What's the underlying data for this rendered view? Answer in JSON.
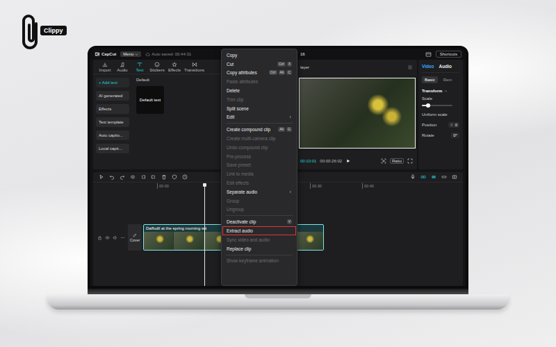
{
  "brand": {
    "name": "Clippy"
  },
  "app": {
    "logo": "CapCut",
    "menu_button": "Menu",
    "autosave": "Auto saved: 00:44:31",
    "project_title": "16",
    "shortcuts_button": "Shortcuts"
  },
  "toolbar": [
    {
      "label": "Import",
      "selected": false
    },
    {
      "label": "Audio",
      "selected": false
    },
    {
      "label": "Text",
      "selected": true
    },
    {
      "label": "Stickers",
      "selected": false
    },
    {
      "label": "Effects",
      "selected": false
    },
    {
      "label": "Transitions",
      "selected": false
    }
  ],
  "text_panel": {
    "nav": [
      {
        "label": "+ Add text",
        "selected": true
      },
      {
        "label": "AI generated",
        "selected": false
      },
      {
        "label": "Effects",
        "selected": false
      },
      {
        "label": "Text template",
        "selected": false
      },
      {
        "label": "Auto captio...",
        "selected": false
      },
      {
        "label": "Local capti...",
        "selected": false
      }
    ],
    "section": "Default",
    "presets": [
      "Default text"
    ]
  },
  "player": {
    "title": "layer",
    "current_time": "00:10:01",
    "duration": "00:00:26:02",
    "ratio_button": "Ratio"
  },
  "inspector": {
    "tabs": [
      {
        "label": "Video",
        "selected": true
      },
      {
        "label": "Audio",
        "selected": false
      }
    ],
    "subtabs": [
      {
        "label": "Basic",
        "selected": true
      },
      {
        "label": "Rem",
        "selected": false
      }
    ],
    "section": "Transform",
    "fields": [
      {
        "kind": "slider",
        "label": "Scale",
        "level": 0.2
      },
      {
        "kind": "label",
        "label": "Uniform scale"
      },
      {
        "kind": "number",
        "label": "Position",
        "axis": "X",
        "value": "0"
      },
      {
        "kind": "number",
        "label": "Rotate",
        "value": "0°"
      }
    ]
  },
  "timeline": {
    "ruler": [
      "00:00",
      "00:30",
      "00:40"
    ],
    "cover_button": "Cover",
    "clip": {
      "title": "Daffodil at the spring morning wit",
      "selected": true
    }
  },
  "context_menu": {
    "items": [
      {
        "kind": "item",
        "label": "Copy",
        "shortcut": [],
        "disabled": false,
        "submenu": false,
        "highlighted": false
      },
      {
        "kind": "item",
        "label": "Cut",
        "shortcut": [
          "Ctrl",
          "X"
        ],
        "disabled": false,
        "submenu": false,
        "highlighted": false
      },
      {
        "kind": "item",
        "label": "Copy attributes",
        "shortcut": [
          "Ctrl",
          "Alt",
          "C"
        ],
        "disabled": false,
        "submenu": false,
        "highlighted": false
      },
      {
        "kind": "item",
        "label": "Paste attributes",
        "shortcut": [],
        "disabled": true,
        "submenu": false,
        "highlighted": false
      },
      {
        "kind": "item",
        "label": "Delete",
        "shortcut": [],
        "disabled": false,
        "submenu": false,
        "highlighted": false
      },
      {
        "kind": "item",
        "label": "Trim clip",
        "shortcut": [],
        "disabled": true,
        "submenu": false,
        "highlighted": false
      },
      {
        "kind": "item",
        "label": "Split scene",
        "shortcut": [],
        "disabled": false,
        "submenu": false,
        "highlighted": false
      },
      {
        "kind": "item",
        "label": "Edit",
        "shortcut": [],
        "disabled": false,
        "submenu": true,
        "highlighted": false
      },
      {
        "kind": "separator"
      },
      {
        "kind": "item",
        "label": "Create compound clip",
        "shortcut": [
          "Alt",
          "G"
        ],
        "disabled": false,
        "submenu": false,
        "highlighted": false
      },
      {
        "kind": "item",
        "label": "Create multi-camera clip",
        "shortcut": [],
        "disabled": true,
        "submenu": false,
        "highlighted": false
      },
      {
        "kind": "item",
        "label": "Undo compound clip",
        "shortcut": [],
        "disabled": true,
        "submenu": false,
        "highlighted": false
      },
      {
        "kind": "item",
        "label": "Pre-process",
        "shortcut": [],
        "disabled": true,
        "submenu": false,
        "highlighted": false
      },
      {
        "kind": "item",
        "label": "Save preset",
        "shortcut": [],
        "disabled": true,
        "submenu": false,
        "highlighted": false
      },
      {
        "kind": "item",
        "label": "Link to media",
        "shortcut": [],
        "disabled": true,
        "submenu": false,
        "highlighted": false
      },
      {
        "kind": "item",
        "label": "Edit effects",
        "shortcut": [],
        "disabled": true,
        "submenu": false,
        "highlighted": false
      },
      {
        "kind": "item",
        "label": "Separate audio",
        "shortcut": [],
        "disabled": false,
        "submenu": true,
        "highlighted": false
      },
      {
        "kind": "item",
        "label": "Group",
        "shortcut": [],
        "disabled": true,
        "submenu": false,
        "highlighted": false
      },
      {
        "kind": "item",
        "label": "Ungroup",
        "shortcut": [],
        "disabled": true,
        "submenu": false,
        "highlighted": false
      },
      {
        "kind": "separator"
      },
      {
        "kind": "item",
        "label": "Deactivate clip",
        "shortcut": [
          "V"
        ],
        "disabled": false,
        "submenu": false,
        "highlighted": false
      },
      {
        "kind": "item",
        "label": "Extract audio",
        "shortcut": [],
        "disabled": false,
        "submenu": false,
        "highlighted": true
      },
      {
        "kind": "item",
        "label": "Sync video and audio",
        "shortcut": [],
        "disabled": true,
        "submenu": false,
        "highlighted": false
      },
      {
        "kind": "item",
        "label": "Replace clip",
        "shortcut": [],
        "disabled": false,
        "submenu": false,
        "highlighted": false
      },
      {
        "kind": "separator"
      },
      {
        "kind": "item",
        "label": "Show keyframe animation",
        "shortcut": [],
        "disabled": true,
        "submenu": false,
        "highlighted": false
      }
    ]
  }
}
